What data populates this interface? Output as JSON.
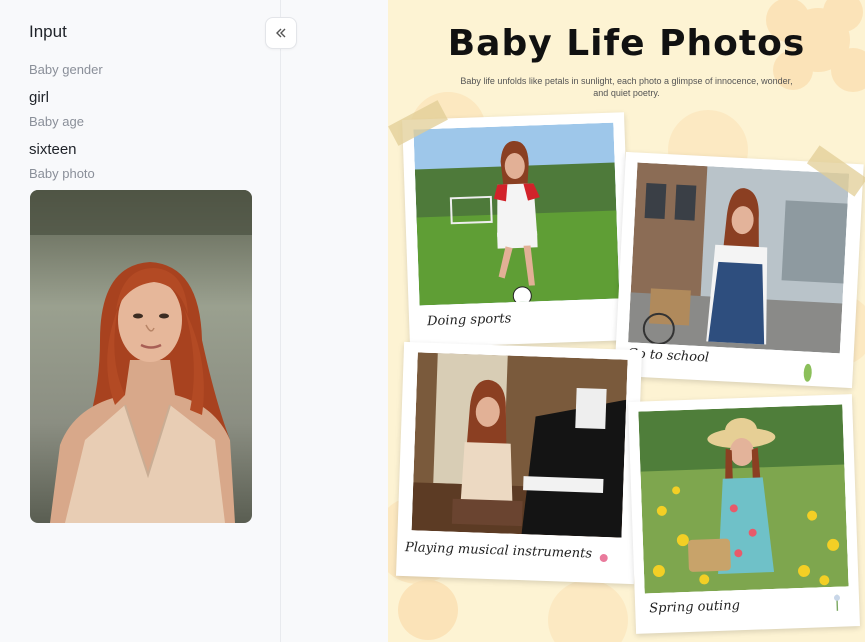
{
  "sidebar": {
    "title": "Input",
    "fields": [
      {
        "label": "Baby gender",
        "value": "girl"
      },
      {
        "label": "Baby age",
        "value": "sixteen"
      },
      {
        "label": "Baby photo"
      }
    ]
  },
  "poster": {
    "title": "Baby Life Photos",
    "subtitle": "Baby life unfolds like petals in sunlight, each photo a glimpse of innocence, wonder, and quiet poetry.",
    "cards": [
      {
        "caption": "Doing sports"
      },
      {
        "caption": "Go to school"
      },
      {
        "caption": "Playing musical instruments"
      },
      {
        "caption": "Spring outing"
      }
    ]
  },
  "colors": {
    "panel_bg": "#f8f9fb",
    "poster_bg": "#fdf3d3",
    "flower": "#fbe3b8"
  }
}
